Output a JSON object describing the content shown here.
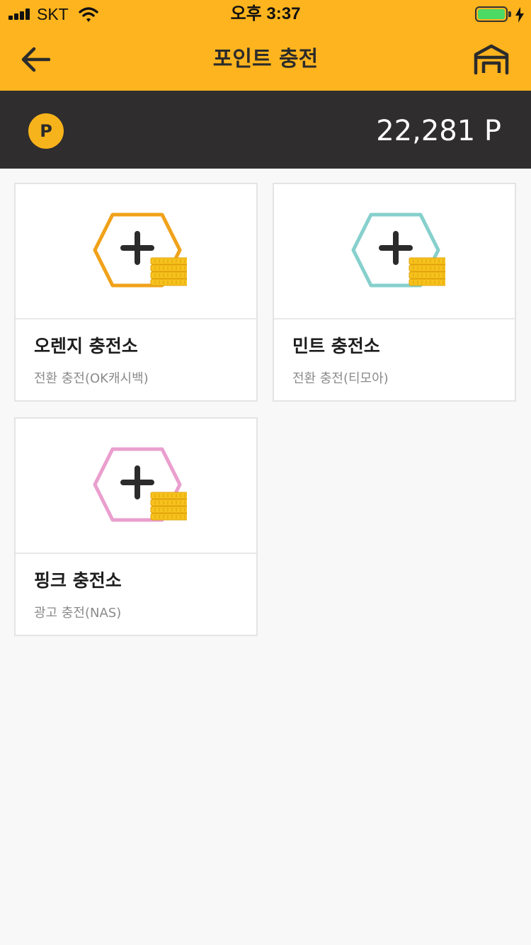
{
  "status_bar": {
    "carrier": "SKT",
    "time": "오후 3:37"
  },
  "nav": {
    "title": "포인트 충전",
    "back_icon": "arrow-left-icon",
    "home_icon": "home-icon"
  },
  "points": {
    "badge": "P",
    "value": "22,281 P"
  },
  "cards": [
    {
      "title": "오렌지 충전소",
      "subtitle": "전환 충전(OK캐시백)",
      "color": "#f0a21a"
    },
    {
      "title": "민트 충전소",
      "subtitle": "전환 충전(티모아)",
      "color": "#86d0cd"
    },
    {
      "title": "핑크 충전소",
      "subtitle": "광고 충전(NAS)",
      "color": "#ea9fce"
    }
  ],
  "colors": {
    "header": "#fdb41e",
    "points_bar": "#2f2d2e",
    "coin": "#f6c21c"
  }
}
